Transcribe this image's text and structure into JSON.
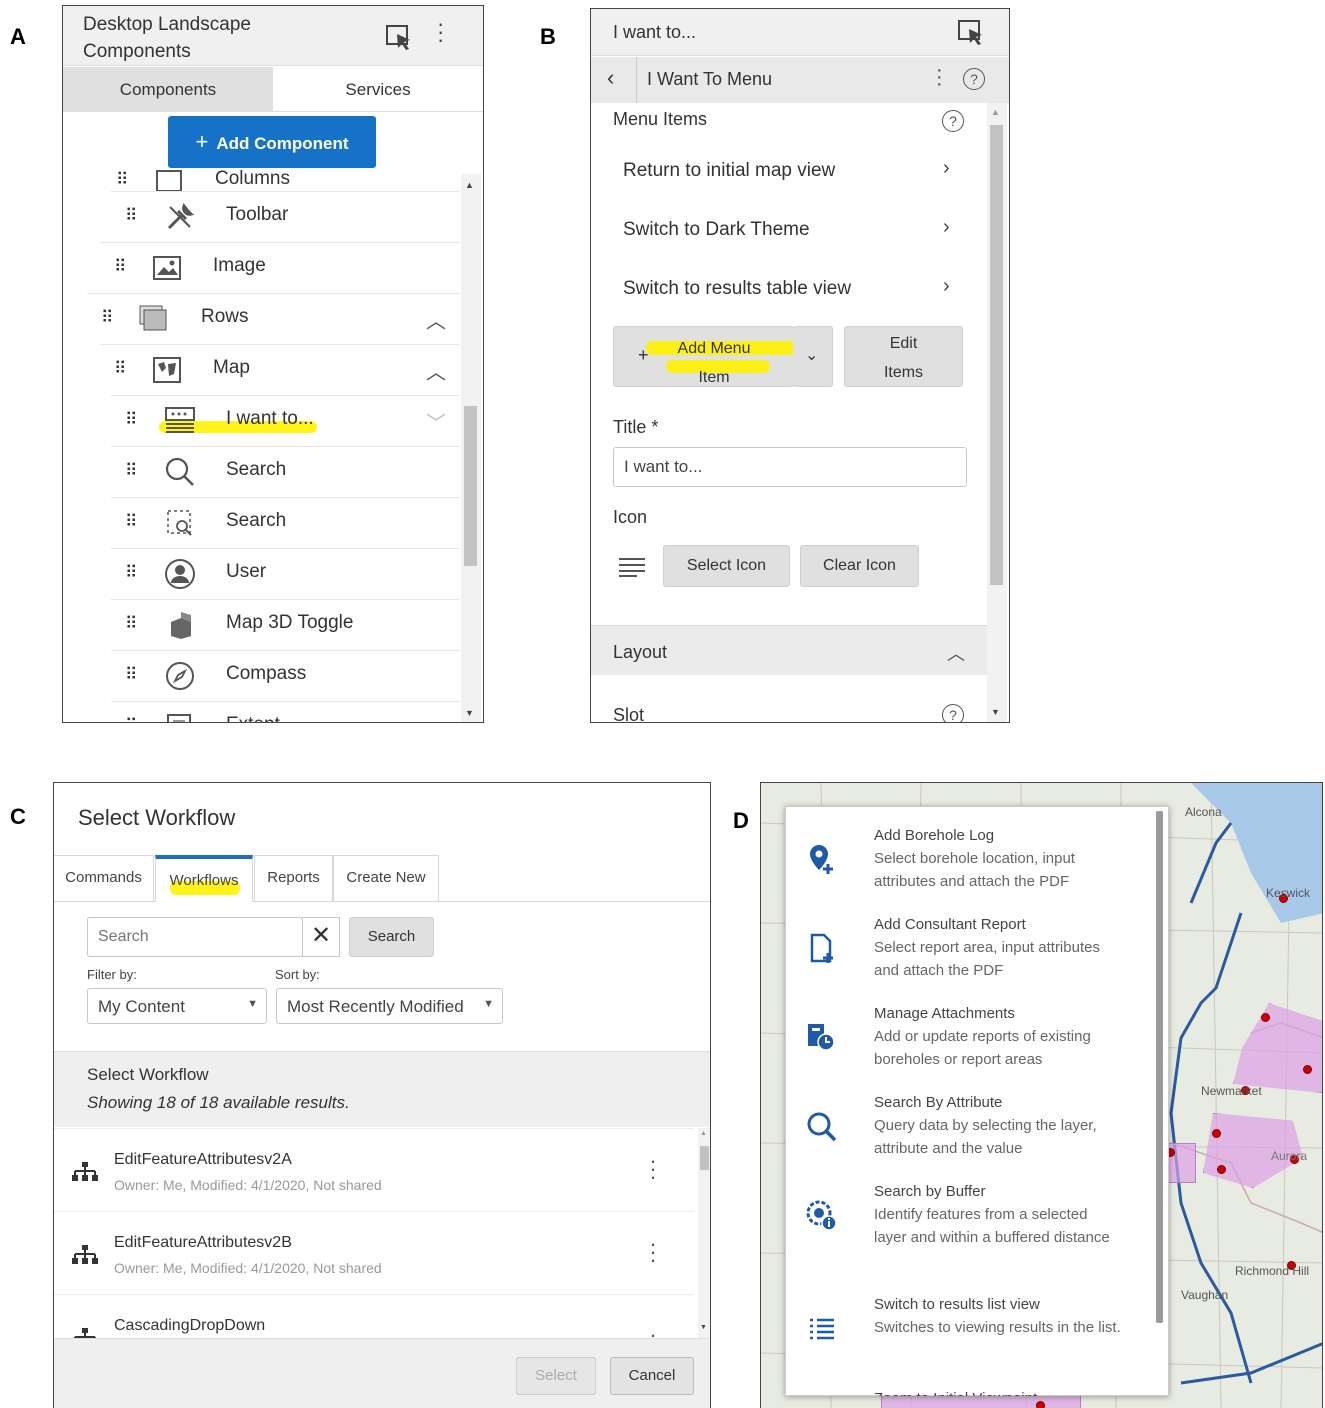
{
  "panel_labels": [
    "A",
    "B",
    "C",
    "D"
  ],
  "panel_a": {
    "title": "Desktop Landscape Components",
    "tabs": [
      "Components",
      "Services"
    ],
    "add_button": "Add Component",
    "items": [
      {
        "label": "Columns",
        "icon": "columns-icon"
      },
      {
        "label": "Toolbar",
        "icon": "tools-icon"
      },
      {
        "label": "Image",
        "icon": "image-icon"
      },
      {
        "label": "Rows",
        "icon": "rows-icon",
        "chevron": "up"
      },
      {
        "label": "Map",
        "icon": "map-icon",
        "chevron": "up"
      },
      {
        "label": "I want to...",
        "icon": "menu-list-icon",
        "chevron": "down",
        "highlighted": true
      },
      {
        "label": "Search",
        "icon": "search-icon"
      },
      {
        "label": "Search",
        "icon": "search-area-icon"
      },
      {
        "label": "User",
        "icon": "user-icon"
      },
      {
        "label": "Map 3D Toggle",
        "icon": "cube-icon"
      },
      {
        "label": "Compass",
        "icon": "compass-icon"
      },
      {
        "label": "Extent",
        "icon": "extent-icon"
      }
    ]
  },
  "panel_b": {
    "header": "I want to...",
    "subheader": "I Want To Menu",
    "menu_items_label": "Menu Items",
    "menu_items": [
      "Return to initial map view",
      "Switch to Dark Theme",
      "Switch to results table view"
    ],
    "add_menu_item_1": "Add Menu",
    "add_menu_item_2": "Item",
    "edit_items_1": "Edit",
    "edit_items_2": "Items",
    "title_label": "Title *",
    "title_value": "I want to...",
    "icon_label": "Icon",
    "select_icon": "Select Icon",
    "clear_icon": "Clear Icon",
    "layout": "Layout",
    "slot": "Slot"
  },
  "panel_c": {
    "title": "Select Workflow",
    "tabs": [
      "Commands",
      "Workflows",
      "Reports",
      "Create New"
    ],
    "active_tab": "Workflows",
    "search_placeholder": "Search",
    "search_button": "Search",
    "filter_label": "Filter by:",
    "filter_value": "My Content",
    "sort_label": "Sort by:",
    "sort_value": "Most Recently Modified",
    "section_title": "Select Workflow",
    "results_text": "Showing 18 of 18 available results.",
    "workflows": [
      {
        "name": "EditFeatureAttributesv2A",
        "meta": "Owner: Me, Modified: 4/1/2020, Not shared"
      },
      {
        "name": "EditFeatureAttributesv2B",
        "meta": "Owner: Me, Modified: 4/1/2020, Not shared"
      },
      {
        "name": "CascadingDropDown",
        "meta": ""
      }
    ],
    "select_button": "Select",
    "cancel_button": "Cancel"
  },
  "panel_d": {
    "menu": [
      {
        "title": "Add Borehole Log",
        "desc": "Select borehole location, input attributes and attach the PDF",
        "icon": "add-location-icon"
      },
      {
        "title": "Add Consultant Report",
        "desc": "Select report area, input attributes and attach the PDF",
        "icon": "add-document-icon"
      },
      {
        "title": "Manage Attachments",
        "desc": "Add or update reports of existing boreholes or report areas",
        "icon": "attachment-clock-icon"
      },
      {
        "title": "Search By Attribute",
        "desc": "Query data by selecting the layer, attribute and the value",
        "icon": "search-icon"
      },
      {
        "title": "Search by Buffer",
        "desc": "Identify features from a selected layer and within a buffered distance",
        "icon": "buffer-info-icon"
      },
      {
        "title": "Switch to results list view",
        "desc": "Switches to viewing results in the list.",
        "icon": "list-icon"
      },
      {
        "title": "Zoom to Initial Viewpoint",
        "desc": "",
        "icon": "zoom-icon"
      }
    ],
    "map_labels": [
      "Alcona",
      "Keswick",
      "Newmarket",
      "Aurora",
      "Richmond Hill",
      "Vaughan"
    ]
  }
}
